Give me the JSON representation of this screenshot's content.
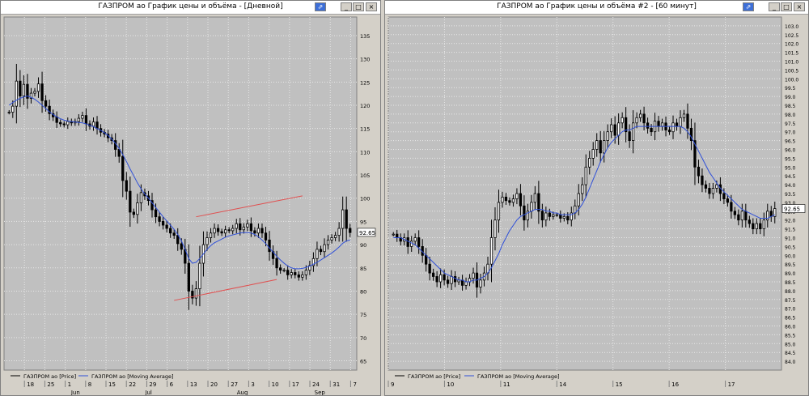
{
  "windows": [
    {
      "title": "ГАЗПРОМ ао График цены и объёма - [Дневной]",
      "buttons": {
        "pin": "⇗",
        "minimize": "_",
        "maximize": "□",
        "close": "×"
      },
      "chart_data": {
        "type": "candlestick",
        "ylim": [
          63,
          139
        ],
        "yticks": [
          65,
          70,
          75,
          80,
          85,
          90,
          95,
          100,
          105,
          110,
          115,
          120,
          125,
          130,
          135
        ],
        "last_price_label": "92.65",
        "last_price": 92.65,
        "x_day_labels": [
          "18",
          "25",
          "1",
          "8",
          "15",
          "22",
          "29",
          "6",
          "13",
          "20",
          "27",
          "3",
          "10",
          "17",
          "24",
          "31",
          "7"
        ],
        "x_month_labels": [
          "Jun",
          "Jul",
          "Aug",
          "Sep"
        ],
        "legend": [
          "ГАЗПРОМ ао [Price]",
          "ГАЗПРОМ ао [Moving Average]"
        ],
        "price_series": [
          118.5,
          119.8,
          125.2,
          122.0,
          124.5,
          121.5,
          122.6,
          123.0,
          124.6,
          121.0,
          119.8,
          118.2,
          117.5,
          116.3,
          116.0,
          115.8,
          116.5,
          116.2,
          116.5,
          117.2,
          117.8,
          116.0,
          115.5,
          116.4,
          115.0,
          114.2,
          113.8,
          113.0,
          112.4,
          110.5,
          109.0,
          103.8,
          101.5,
          97.0,
          96.5,
          99.0,
          101.2,
          100.5,
          99.5,
          97.5,
          96.0,
          95.0,
          94.2,
          93.5,
          92.5,
          92.0,
          90.2,
          89.0,
          86.0,
          80.0,
          78.5,
          80.5,
          86.0,
          90.0,
          91.5,
          92.5,
          93.5,
          92.8,
          92.5,
          93.2,
          93.0,
          93.5,
          94.5,
          93.2,
          93.8,
          94.5,
          93.0,
          92.5,
          93.5,
          92.5,
          91.0,
          88.5,
          87.0,
          85.0,
          84.5,
          84.5,
          83.5,
          84.0,
          83.5,
          83.0,
          83.5,
          84.5,
          85.5,
          87.0,
          89.0,
          88.5,
          90.0,
          91.0,
          91.5,
          92.0,
          93.5,
          97.5,
          93.5,
          92.6
        ],
        "moving_average": [
          120.0,
          120.6,
          121.1,
          121.5,
          121.8,
          122.0,
          121.7,
          121.3,
          120.7,
          120.0,
          119.3,
          118.6,
          118.0,
          117.5,
          117.1,
          116.8,
          116.6,
          116.5,
          116.4,
          116.3,
          116.2,
          116.0,
          115.7,
          115.4,
          115.0,
          114.6,
          114.1,
          113.5,
          112.7,
          111.8,
          110.7,
          109.4,
          107.9,
          106.3,
          104.8,
          103.3,
          102.0,
          100.9,
          100.0,
          99.0,
          98.0,
          97.0,
          96.0,
          95.1,
          94.2,
          93.3,
          92.2,
          90.8,
          89.0,
          87.0,
          86.0,
          86.2,
          87.0,
          88.0,
          89.0,
          89.8,
          90.4,
          90.8,
          91.2,
          91.6,
          91.9,
          92.1,
          92.3,
          92.5,
          92.6,
          92.6,
          92.5,
          92.2,
          91.7,
          91.0,
          90.2,
          89.3,
          88.4,
          87.5,
          86.7,
          86.0,
          85.4,
          85.0,
          84.8,
          84.8,
          84.9,
          85.1,
          85.4,
          85.8,
          86.2,
          86.7,
          87.2,
          87.7,
          88.2,
          88.8,
          89.5,
          90.3,
          90.8,
          91.0
        ],
        "trendlines": [
          {
            "from": [
              45,
              78.0
            ],
            "to": [
              73,
              82.5
            ]
          },
          {
            "from": [
              51,
              96.0
            ],
            "to": [
              80,
              100.5
            ]
          }
        ]
      }
    },
    {
      "title": "ГАЗПРОМ ао График цены и объёма #2 - [60 минут]",
      "buttons": {
        "pin": "⇗",
        "minimize": "_",
        "maximize": "□",
        "close": "×"
      },
      "chart_data": {
        "type": "candlestick",
        "ylim": [
          83.5,
          103.5
        ],
        "yticks": [
          84.0,
          84.5,
          85.0,
          85.5,
          86.0,
          86.5,
          87.0,
          87.5,
          88.0,
          88.5,
          89.0,
          89.5,
          90.0,
          90.5,
          91.0,
          91.5,
          92.0,
          92.5,
          93.0,
          93.5,
          94.0,
          94.5,
          95.0,
          95.5,
          96.0,
          96.5,
          97.0,
          97.5,
          98.0,
          98.5,
          99.0,
          99.5,
          100.0,
          100.5,
          101.0,
          101.5,
          102.0,
          102.5,
          103.0
        ],
        "last_price_label": "92.65",
        "last_price": 92.65,
        "x_day_labels": [
          "9",
          "10",
          "11",
          "14",
          "15",
          "16",
          "17"
        ],
        "legend": [
          "ГАЗПРОМ ао [Price]",
          "ГАЗПРОМ ао [Moving Average]"
        ],
        "price_series": [
          91.2,
          91.0,
          90.8,
          91.0,
          90.5,
          90.8,
          91.0,
          90.5,
          90.0,
          89.5,
          89.0,
          88.8,
          88.5,
          88.9,
          88.6,
          88.4,
          88.8,
          88.5,
          88.6,
          88.3,
          88.5,
          88.7,
          89.0,
          88.2,
          88.6,
          89.0,
          89.5,
          91.0,
          92.0,
          93.0,
          93.3,
          93.1,
          93.0,
          93.2,
          93.5,
          92.8,
          92.0,
          92.5,
          93.0,
          93.5,
          92.5,
          92.0,
          92.4,
          92.2,
          92.3,
          92.3,
          92.1,
          92.2,
          92.0,
          92.4,
          92.8,
          93.5,
          94.0,
          95.0,
          95.5,
          96.0,
          96.5,
          95.8,
          96.5,
          97.0,
          97.4,
          96.8,
          97.5,
          97.8,
          97.0,
          96.5,
          97.5,
          97.8,
          98.0,
          97.5,
          97.2,
          97.0,
          97.6,
          97.3,
          97.5,
          97.1,
          97.0,
          97.5,
          97.3,
          97.8,
          98.0,
          97.2,
          96.5,
          95.0,
          94.5,
          94.0,
          93.8,
          93.5,
          93.8,
          94.0,
          93.5,
          93.2,
          93.0,
          92.5,
          92.3,
          92.0,
          92.5,
          92.0,
          91.8,
          91.5,
          91.8,
          91.5,
          92.0,
          92.5,
          92.2,
          92.65
        ],
        "moving_average": [
          91.0,
          91.0,
          91.0,
          90.9,
          90.8,
          90.7,
          90.6,
          90.4,
          90.2,
          90.0,
          89.8,
          89.6,
          89.4,
          89.2,
          89.0,
          88.9,
          88.8,
          88.7,
          88.6,
          88.6,
          88.5,
          88.5,
          88.6,
          88.6,
          88.7,
          88.8,
          89.0,
          89.3,
          89.7,
          90.1,
          90.6,
          91.0,
          91.4,
          91.7,
          92.0,
          92.2,
          92.3,
          92.4,
          92.5,
          92.6,
          92.6,
          92.6,
          92.5,
          92.5,
          92.4,
          92.4,
          92.3,
          92.3,
          92.3,
          92.3,
          92.4,
          92.6,
          92.9,
          93.3,
          93.8,
          94.3,
          94.8,
          95.3,
          95.7,
          96.1,
          96.4,
          96.6,
          96.8,
          97.0,
          97.1,
          97.1,
          97.2,
          97.3,
          97.3,
          97.3,
          97.3,
          97.3,
          97.3,
          97.3,
          97.3,
          97.3,
          97.3,
          97.3,
          97.3,
          97.3,
          97.2,
          97.0,
          96.7,
          96.3,
          95.9,
          95.5,
          95.1,
          94.7,
          94.4,
          94.1,
          93.8,
          93.6,
          93.4,
          93.2,
          93.0,
          92.8,
          92.6,
          92.5,
          92.4,
          92.3,
          92.2,
          92.1,
          92.1,
          92.1,
          92.2,
          92.3
        ]
      }
    }
  ],
  "colors": {
    "plot_bg": "#c0c0c0",
    "grid": "#e8e8e8",
    "candle": "#000000",
    "moving_average": "#3050d8",
    "trendline": "#e05050",
    "price_label_bg": "#ffffff"
  }
}
